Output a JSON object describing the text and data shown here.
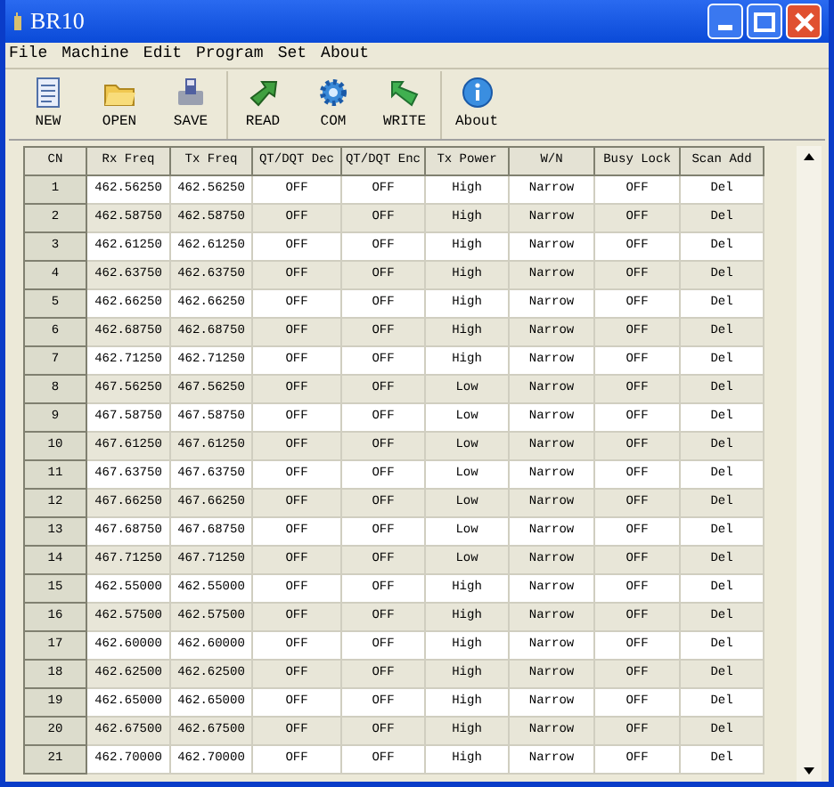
{
  "window": {
    "title": "BR10"
  },
  "menu": [
    "File",
    "Machine",
    "Edit",
    "Program",
    "Set",
    "About"
  ],
  "toolbar": [
    {
      "label": "NEW",
      "kind": "doc"
    },
    {
      "label": "OPEN",
      "kind": "folder"
    },
    {
      "label": "SAVE",
      "kind": "disk"
    },
    {
      "label": "READ",
      "kind": "read"
    },
    {
      "label": "COM",
      "kind": "gear"
    },
    {
      "label": "WRITE",
      "kind": "write"
    },
    {
      "label": "About",
      "kind": "info"
    }
  ],
  "table": {
    "columns": [
      "CN",
      "Rx Freq",
      "Tx Freq",
      "QT/DQT Dec",
      "QT/DQT Enc",
      "Tx Power",
      "W/N",
      "Busy Lock",
      "Scan Add"
    ],
    "rows": [
      [
        "1",
        "462.56250",
        "462.56250",
        "OFF",
        "OFF",
        "High",
        "Narrow",
        "OFF",
        "Del"
      ],
      [
        "2",
        "462.58750",
        "462.58750",
        "OFF",
        "OFF",
        "High",
        "Narrow",
        "OFF",
        "Del"
      ],
      [
        "3",
        "462.61250",
        "462.61250",
        "OFF",
        "OFF",
        "High",
        "Narrow",
        "OFF",
        "Del"
      ],
      [
        "4",
        "462.63750",
        "462.63750",
        "OFF",
        "OFF",
        "High",
        "Narrow",
        "OFF",
        "Del"
      ],
      [
        "5",
        "462.66250",
        "462.66250",
        "OFF",
        "OFF",
        "High",
        "Narrow",
        "OFF",
        "Del"
      ],
      [
        "6",
        "462.68750",
        "462.68750",
        "OFF",
        "OFF",
        "High",
        "Narrow",
        "OFF",
        "Del"
      ],
      [
        "7",
        "462.71250",
        "462.71250",
        "OFF",
        "OFF",
        "High",
        "Narrow",
        "OFF",
        "Del"
      ],
      [
        "8",
        "467.56250",
        "467.56250",
        "OFF",
        "OFF",
        "Low",
        "Narrow",
        "OFF",
        "Del"
      ],
      [
        "9",
        "467.58750",
        "467.58750",
        "OFF",
        "OFF",
        "Low",
        "Narrow",
        "OFF",
        "Del"
      ],
      [
        "10",
        "467.61250",
        "467.61250",
        "OFF",
        "OFF",
        "Low",
        "Narrow",
        "OFF",
        "Del"
      ],
      [
        "11",
        "467.63750",
        "467.63750",
        "OFF",
        "OFF",
        "Low",
        "Narrow",
        "OFF",
        "Del"
      ],
      [
        "12",
        "467.66250",
        "467.66250",
        "OFF",
        "OFF",
        "Low",
        "Narrow",
        "OFF",
        "Del"
      ],
      [
        "13",
        "467.68750",
        "467.68750",
        "OFF",
        "OFF",
        "Low",
        "Narrow",
        "OFF",
        "Del"
      ],
      [
        "14",
        "467.71250",
        "467.71250",
        "OFF",
        "OFF",
        "Low",
        "Narrow",
        "OFF",
        "Del"
      ],
      [
        "15",
        "462.55000",
        "462.55000",
        "OFF",
        "OFF",
        "High",
        "Narrow",
        "OFF",
        "Del"
      ],
      [
        "16",
        "462.57500",
        "462.57500",
        "OFF",
        "OFF",
        "High",
        "Narrow",
        "OFF",
        "Del"
      ],
      [
        "17",
        "462.60000",
        "462.60000",
        "OFF",
        "OFF",
        "High",
        "Narrow",
        "OFF",
        "Del"
      ],
      [
        "18",
        "462.62500",
        "462.62500",
        "OFF",
        "OFF",
        "High",
        "Narrow",
        "OFF",
        "Del"
      ],
      [
        "19",
        "462.65000",
        "462.65000",
        "OFF",
        "OFF",
        "High",
        "Narrow",
        "OFF",
        "Del"
      ],
      [
        "20",
        "462.67500",
        "462.67500",
        "OFF",
        "OFF",
        "High",
        "Narrow",
        "OFF",
        "Del"
      ],
      [
        "21",
        "462.70000",
        "462.70000",
        "OFF",
        "OFF",
        "High",
        "Narrow",
        "OFF",
        "Del"
      ]
    ]
  }
}
